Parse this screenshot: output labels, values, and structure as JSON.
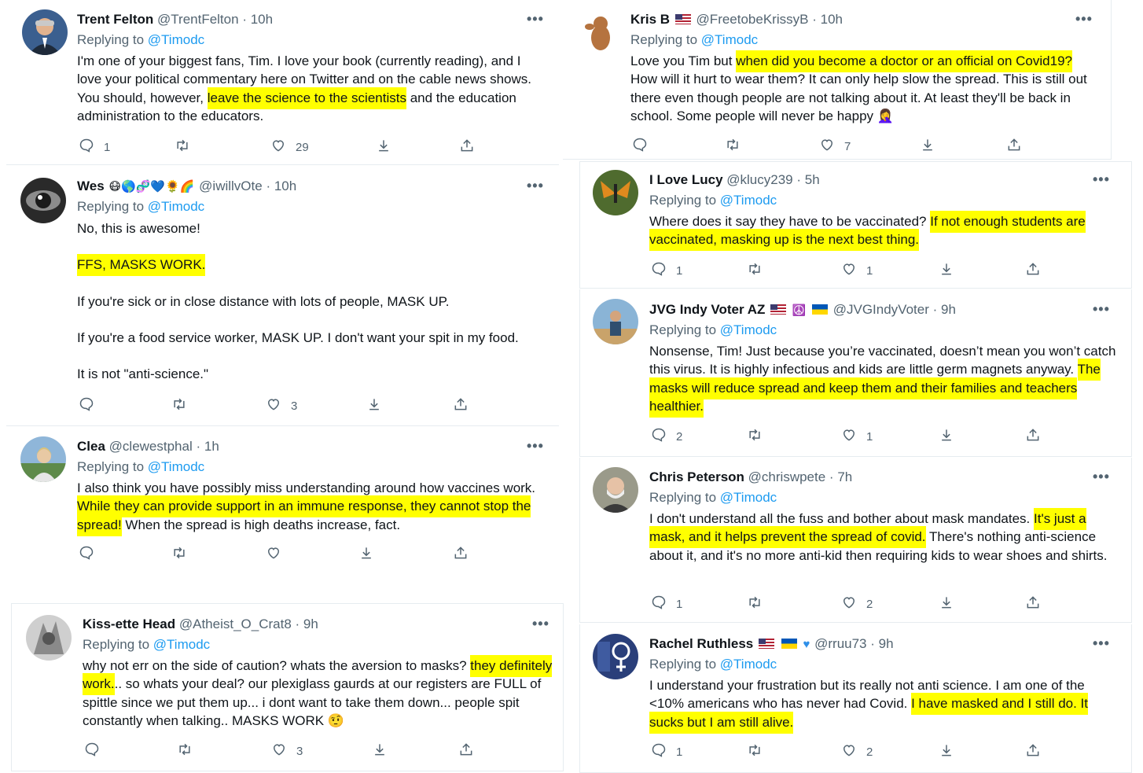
{
  "tweets": [
    {
      "name": "Trent Felton",
      "handle": "@TrentFelton",
      "time": "10h",
      "replying_prefix": "Replying to",
      "replying_to": "@Timodc",
      "body_parts": [
        {
          "t": "I'm one of your biggest fans, Tim. I love your book (currently reading), and I love your political commentary here on Twitter and on the cable news shows.  You should, however, "
        },
        {
          "t": "leave the science to the scientists",
          "hl": true
        },
        {
          "t": " and the education administration to the educators."
        }
      ],
      "replies": "1",
      "retweets": "",
      "likes": "29"
    },
    {
      "name": "Wes",
      "name_emoji": "😷🌎🧬💙🌻🌈",
      "handle": "@iwillvOte",
      "time": "10h",
      "replying_prefix": "Replying to",
      "replying_to": "@Timodc",
      "line1": "No, this is awesome!",
      "line2": "FFS, MASKS WORK.",
      "line3": "If you're sick or in close distance with lots of people, MASK UP.",
      "line4": "If you're a food service worker, MASK UP. I don't want your spit in my food.",
      "line5": "It is not \"anti-science.\"",
      "replies": "",
      "retweets": "",
      "likes": "3"
    },
    {
      "name": "Clea",
      "handle": "@clewestphal",
      "time": "1h",
      "replying_prefix": "Replying to",
      "replying_to": "@Timodc",
      "text_a": "I also think you have possibly miss understanding around how vaccines work. ",
      "text_hl": "While they can provide support in an immune response, they cannot stop the spread!",
      "text_b": " When the spread is high deaths increase, fact.",
      "replies": "",
      "retweets": "",
      "likes": ""
    },
    {
      "name": "Kiss-ette Head",
      "handle": "@Atheist_O_Crat8",
      "time": "9h",
      "replying_prefix": "Replying to",
      "replying_to": "@Timodc",
      "text_a": "why not err on the side of caution? whats the aversion to masks? ",
      "text_hl": "they definitely work.",
      "text_b": ".. so whats your deal?  our plexiglass gaurds at our registers are FULL of spittle since we put them up... i dont want to take them down... people spit constantly when talking.. MASKS WORK 🤨",
      "replies": "",
      "retweets": "",
      "likes": "3"
    },
    {
      "name": "Kris B",
      "handle": "@FreetobeKrissyB",
      "time": "10h",
      "replying_prefix": "Replying to",
      "replying_to": "@Timodc",
      "text_a": "Love you Tim but ",
      "text_hl": "when did you become a doctor or an official on Covid19?",
      "text_b": " How will it hurt to wear them?  It can only help slow the spread. This is still out there even though people are not talking about it. At least they'll be back in school. Some people will never be happy 🤦‍♀️",
      "replies": "",
      "retweets": "",
      "likes": "7"
    },
    {
      "name": "I Love Lucy",
      "handle": "@klucy239",
      "time": "5h",
      "replying_prefix": "Replying to",
      "replying_to": "@Timodc",
      "text_a": "Where does it say they have to be vaccinated? ",
      "text_hl": "If not enough students are vaccinated, masking up is the next best thing.",
      "text_b": "",
      "replies": "1",
      "retweets": "",
      "likes": "1"
    },
    {
      "name": "JVG Indy Voter AZ",
      "handle": "@JVGIndyVoter",
      "time": "9h",
      "replying_prefix": "Replying to",
      "replying_to": "@Timodc",
      "text_a": "Nonsense, Tim! Just because you’re vaccinated, doesn’t mean you won’t catch this virus. It is highly infectious and kids are little germ magnets anyway. ",
      "text_hl": "The masks will reduce spread and keep them and their families and teachers healthier.",
      "text_b": "",
      "replies": "2",
      "retweets": "",
      "likes": "1"
    },
    {
      "name": "Chris Peterson",
      "handle": "@chriswpete",
      "time": "7h",
      "replying_prefix": "Replying to",
      "replying_to": "@Timodc",
      "text_a": "I don't understand all the fuss and bother about mask mandates. ",
      "text_hl": "It's just a mask, and it helps prevent the spread of covid.",
      "text_b": " There's nothing anti-science about it, and it's no more anti-kid then requiring kids to wear shoes and shirts.",
      "replies": "1",
      "retweets": "",
      "likes": "2"
    },
    {
      "name": "Rachel Ruthless",
      "handle": "@rruu73",
      "time": "9h",
      "replying_prefix": "Replying to",
      "replying_to": "@Timodc",
      "text_a": "I understand your frustration but its really not anti science.  I am one of the <10% americans who has never had Covid. ",
      "text_hl": "I have masked and I still do.  It sucks but I am still alive.",
      "text_b": "",
      "replies": "1",
      "retweets": "",
      "likes": "2"
    }
  ],
  "more_label": "•••",
  "dot": "·",
  "colors": {
    "highlight": "#ffff00",
    "mention": "#1d9bf0",
    "muted": "#536471"
  }
}
